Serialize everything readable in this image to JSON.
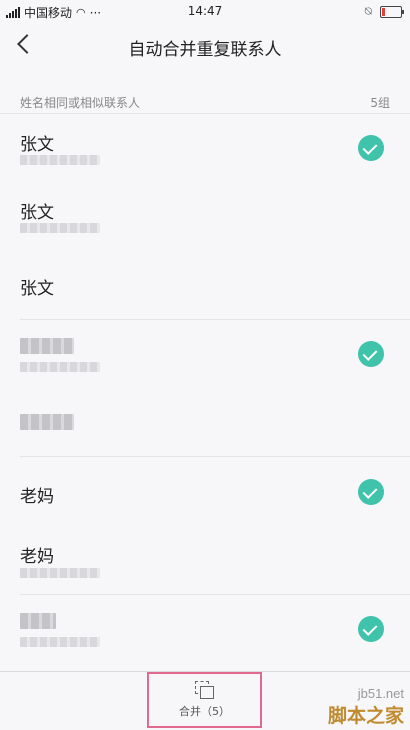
{
  "status_bar": {
    "carrier": "中国移动",
    "more": "···",
    "time": "14:47"
  },
  "header": {
    "title": "自动合并重复联系人"
  },
  "section": {
    "label": "姓名相同或相似联系人",
    "count": "5组"
  },
  "contacts": [
    {
      "name": "张文",
      "checked": true
    },
    {
      "name": "张文",
      "checked": false
    },
    {
      "name": "张文",
      "checked": false
    },
    {
      "name": "",
      "checked": true
    },
    {
      "name": "",
      "checked": false
    },
    {
      "name": "老妈",
      "checked": true
    },
    {
      "name": "老妈",
      "checked": false
    },
    {
      "name": "",
      "checked": true
    }
  ],
  "bottom_bar": {
    "merge_label": "合并（5）"
  },
  "watermark": {
    "site": "jb51.net",
    "brand": "脚本之家"
  },
  "colors": {
    "accent": "#3fc3ab",
    "highlight": "#e06a8e"
  }
}
